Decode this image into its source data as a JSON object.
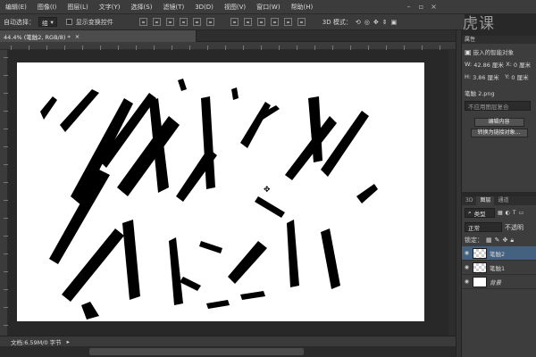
{
  "menubar": {
    "items": [
      "编辑(E)",
      "图像(I)",
      "图层(L)",
      "文字(Y)",
      "选择(S)",
      "滤镜(T)",
      "3D(D)",
      "视图(V)",
      "窗口(W)",
      "帮助(H)"
    ]
  },
  "options": {
    "auto_select_label": "自动选择：",
    "auto_select_value": "组",
    "show_transform_label": "显示变换控件",
    "mode_3d_label": "3D 模式："
  },
  "logo": {
    "text": "虎课"
  },
  "document": {
    "tab_title": "44.4% (笔触2, RGB/8) *",
    "zoom": "44.4%"
  },
  "status": {
    "doc_info": "文档:6.59M/0 字节"
  },
  "properties": {
    "tab_label": "属性",
    "type_label": "嵌入的智能对象",
    "w_label": "W:",
    "w_value": "42.86 厘米",
    "x_label": "X:",
    "x_value": "0 厘米",
    "h_label": "H:",
    "h_value": "3.86 厘米",
    "y_label": "Y:",
    "y_value": "0 厘米",
    "file_name": "笔触 2.png",
    "comp_value": "不应用图层复合",
    "edit_contents_btn": "编辑内容",
    "convert_btn": "转换为链接对象..."
  },
  "layers": {
    "tabs": [
      "3D",
      "图层",
      "通道"
    ],
    "filter_label": "类型",
    "blend_mode": "正常",
    "opacity_label": "不透明",
    "lock_label": "锁定：",
    "items": [
      {
        "name": "笔触2",
        "selected": true
      },
      {
        "name": "笔触1",
        "selected": false
      },
      {
        "name": "背景",
        "selected": false
      }
    ]
  },
  "colors": {
    "selected_layer": "#44627f",
    "panel_bg": "#3d3d3d",
    "canvas_bg": "#ffffff"
  }
}
